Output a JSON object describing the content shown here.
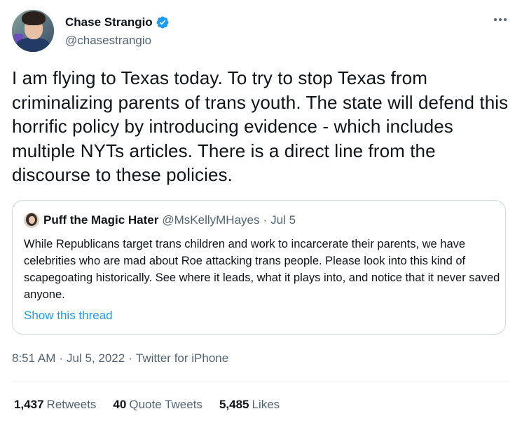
{
  "colors": {
    "text_primary": "#0f1419",
    "text_secondary": "#536471",
    "accent_blue": "#1d9bf0",
    "border": "#cfd9de",
    "divider": "#eff3f4"
  },
  "author": {
    "display_name": "Chase Strangio",
    "handle": "@chasestrangio",
    "verified": true,
    "avatar_icon": "user-avatar"
  },
  "more_icon": "more-horizontal-icon",
  "tweet": {
    "text": "I am flying to Texas today. To try to stop Texas from criminalizing parents of trans youth. The state will defend this horrific policy by introducing evidence - which includes multiple NYTs articles. There is a direct line from the discourse to these policies."
  },
  "quote": {
    "display_name": "Puff the Magic Hater",
    "handle": "@MsKellyMHayes",
    "separator": "·",
    "date": "Jul 5",
    "text": "While Republicans target trans children and work to incarcerate their parents, we have celebrities who are mad about Roe attacking trans people. Please look into this kind of scapegoating historically. See where it leads, what it plays into, and notice that it never saved anyone.",
    "show_thread": "Show this thread"
  },
  "meta": {
    "time": "8:51 AM",
    "separator": "·",
    "date": "Jul 5, 2022",
    "source": "Twitter for iPhone"
  },
  "stats": {
    "retweets_count": "1,437",
    "retweets_label": "Retweets",
    "quotes_count": "40",
    "quotes_label": "Quote Tweets",
    "likes_count": "5,485",
    "likes_label": "Likes"
  }
}
